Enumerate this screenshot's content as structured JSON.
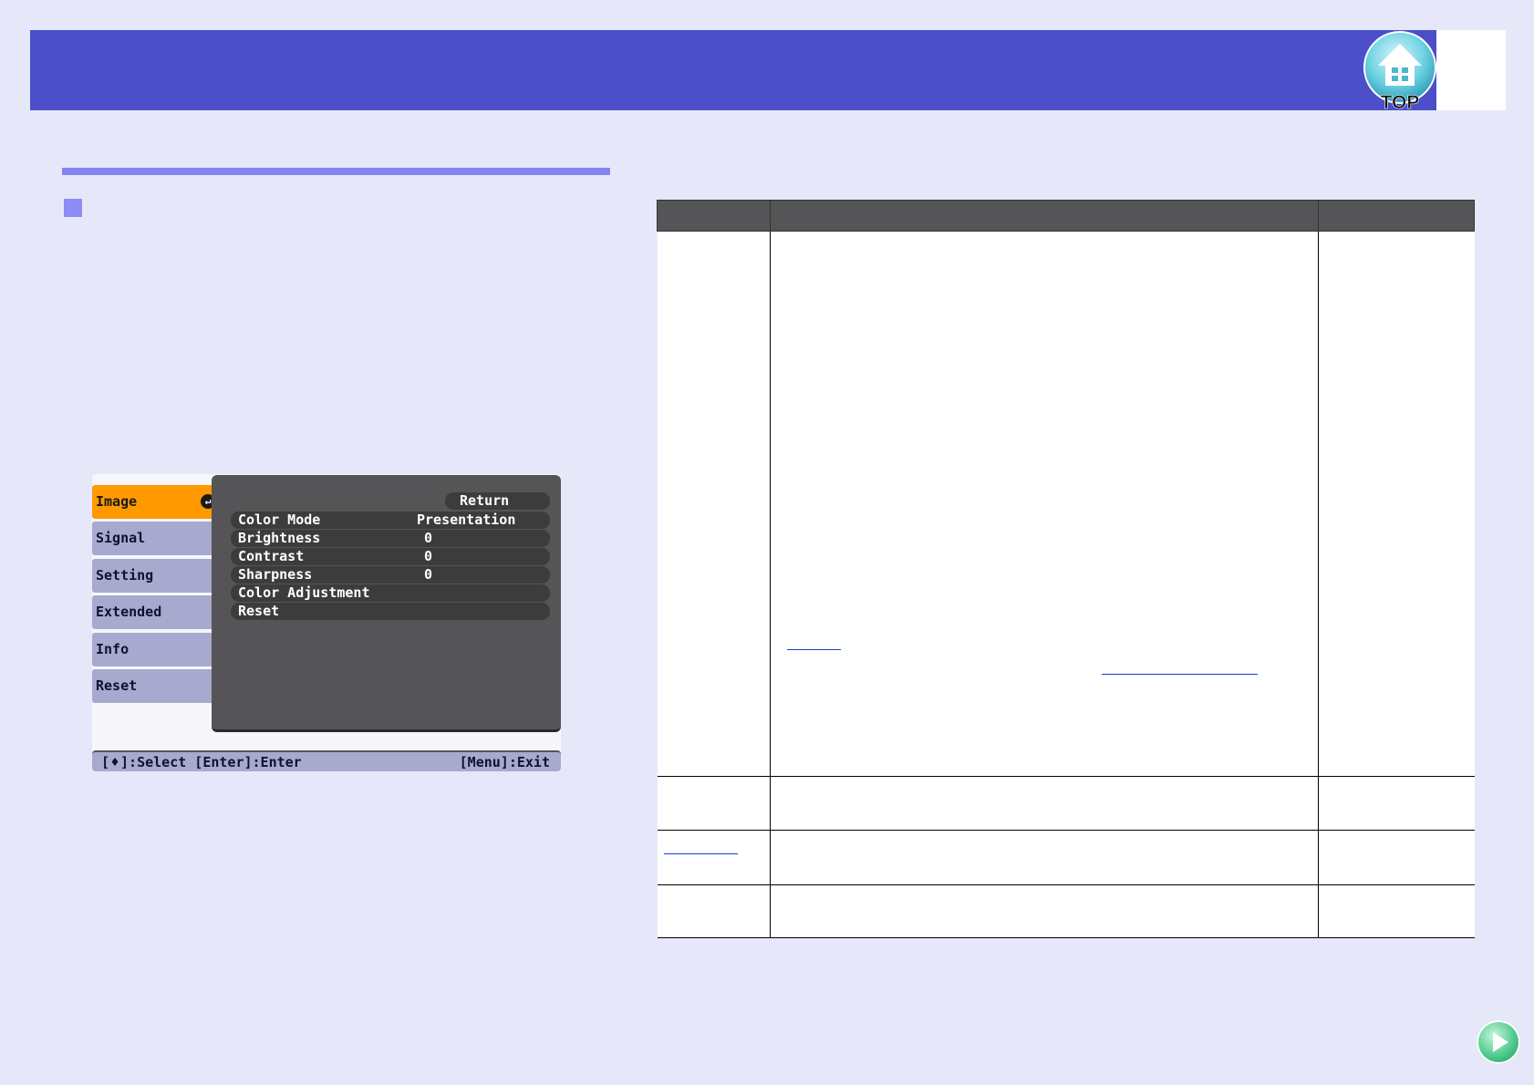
{
  "header": {
    "top_button_label": "TOP"
  },
  "osd": {
    "tabs": [
      {
        "label": "Image",
        "active": true
      },
      {
        "label": "Signal",
        "active": false
      },
      {
        "label": "Setting",
        "active": false
      },
      {
        "label": "Extended",
        "active": false
      },
      {
        "label": "Info",
        "active": false
      },
      {
        "label": "Reset",
        "active": false
      }
    ],
    "return_label": "Return",
    "rows": [
      {
        "label": "Color Mode",
        "value": "Presentation"
      },
      {
        "label": "Brightness",
        "value": "0"
      },
      {
        "label": "Contrast",
        "value": "0"
      },
      {
        "label": "Sharpness",
        "value": "0"
      },
      {
        "label": "Color Adjustment",
        "value": ""
      },
      {
        "label": "Reset",
        "value": ""
      }
    ],
    "footer_left": "]:Select [Enter]:Enter",
    "footer_left_prefix": "[",
    "footer_right": "[Menu]:Exit"
  },
  "colors": {
    "header": "#4c4fc9",
    "accent_rule": "#8585f0",
    "active_tab": "#ff9900"
  }
}
